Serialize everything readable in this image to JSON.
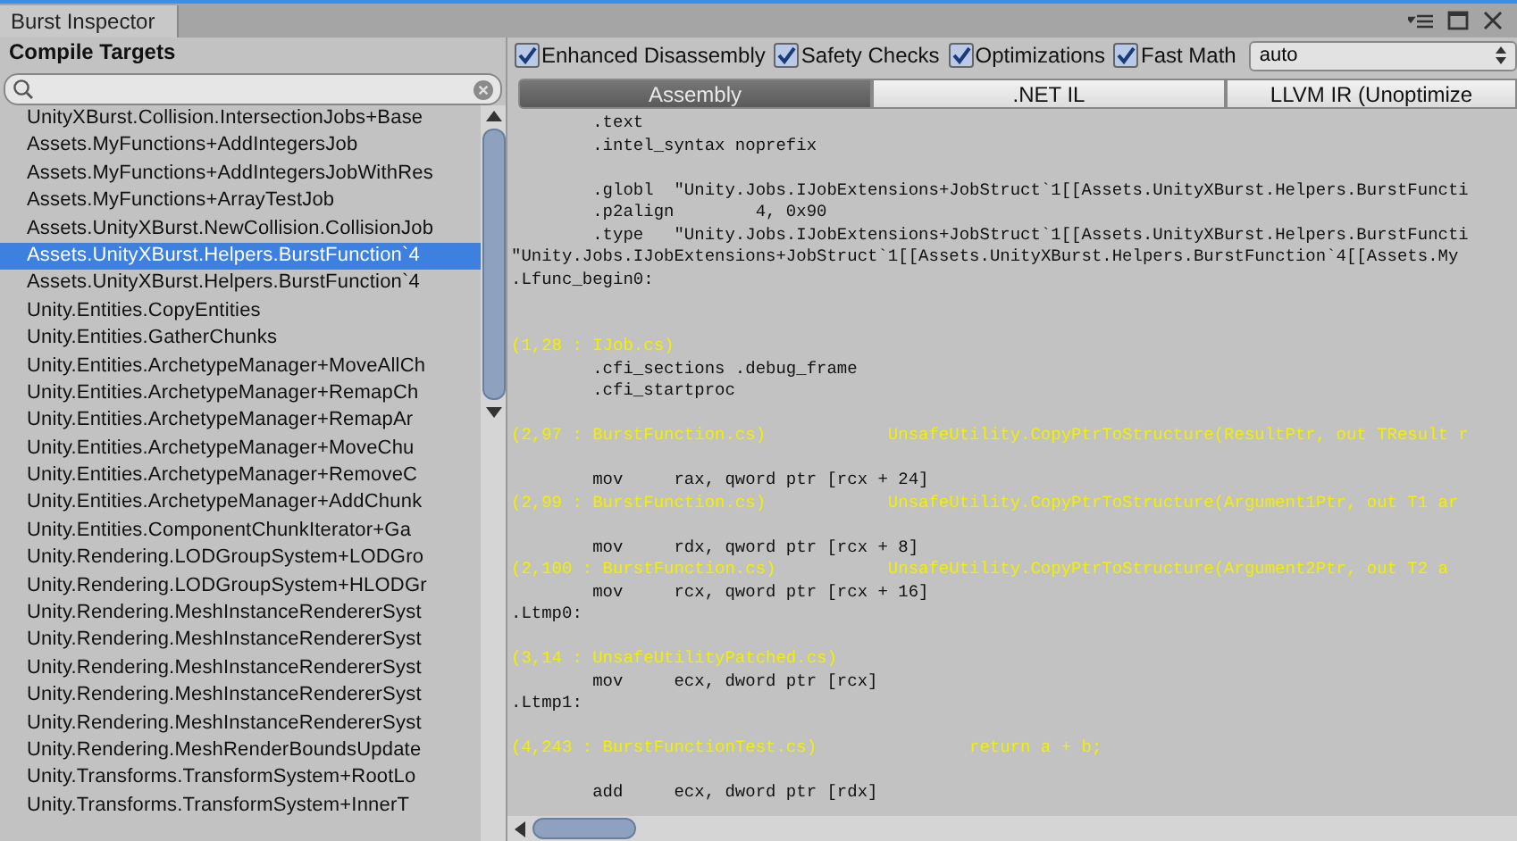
{
  "window": {
    "title": "Burst Inspector"
  },
  "sidebar": {
    "title": "Compile Targets",
    "items": [
      {
        "label": "UnityXBurst.Collision.IntersectionJobs+Base",
        "selected": false
      },
      {
        "label": "Assets.MyFunctions+AddIntegersJob",
        "selected": false
      },
      {
        "label": "Assets.MyFunctions+AddIntegersJobWithRes",
        "selected": false
      },
      {
        "label": "Assets.MyFunctions+ArrayTestJob",
        "selected": false
      },
      {
        "label": "Assets.UnityXBurst.NewCollision.CollisionJob",
        "selected": false
      },
      {
        "label": "Assets.UnityXBurst.Helpers.BurstFunction`4",
        "selected": true
      },
      {
        "label": "Assets.UnityXBurst.Helpers.BurstFunction`4",
        "selected": false
      },
      {
        "label": "Unity.Entities.CopyEntities",
        "selected": false
      },
      {
        "label": "Unity.Entities.GatherChunks",
        "selected": false
      },
      {
        "label": "Unity.Entities.ArchetypeManager+MoveAllCh",
        "selected": false
      },
      {
        "label": "Unity.Entities.ArchetypeManager+RemapCh",
        "selected": false
      },
      {
        "label": "Unity.Entities.ArchetypeManager+RemapAr",
        "selected": false
      },
      {
        "label": "Unity.Entities.ArchetypeManager+MoveChu",
        "selected": false
      },
      {
        "label": "Unity.Entities.ArchetypeManager+RemoveC",
        "selected": false
      },
      {
        "label": "Unity.Entities.ArchetypeManager+AddChunk",
        "selected": false
      },
      {
        "label": "Unity.Entities.ComponentChunkIterator+Ga",
        "selected": false
      },
      {
        "label": "Unity.Rendering.LODGroupSystem+LODGro",
        "selected": false
      },
      {
        "label": "Unity.Rendering.LODGroupSystem+HLODGr",
        "selected": false
      },
      {
        "label": "Unity.Rendering.MeshInstanceRendererSyst",
        "selected": false
      },
      {
        "label": "Unity.Rendering.MeshInstanceRendererSyst",
        "selected": false
      },
      {
        "label": "Unity.Rendering.MeshInstanceRendererSyst",
        "selected": false
      },
      {
        "label": "Unity.Rendering.MeshInstanceRendererSyst",
        "selected": false
      },
      {
        "label": "Unity.Rendering.MeshInstanceRendererSyst",
        "selected": false
      },
      {
        "label": "Unity.Rendering.MeshRenderBoundsUpdate",
        "selected": false
      },
      {
        "label": "Unity.Transforms.TransformSystem+RootLo",
        "selected": false
      },
      {
        "label": "Unity.Transforms.TransformSystem+InnerT",
        "selected": false
      }
    ]
  },
  "options": [
    {
      "label": "Enhanced Disassembly",
      "checked": true
    },
    {
      "label": "Safety Checks",
      "checked": true
    },
    {
      "label": "Optimizations",
      "checked": true
    },
    {
      "label": "Fast Math",
      "checked": true
    }
  ],
  "target_dropdown": {
    "value": "auto"
  },
  "tabs": [
    {
      "label": "Assembly",
      "selected": true
    },
    {
      "label": ".NET IL",
      "selected": false
    },
    {
      "label": "LLVM IR (Unoptimize",
      "selected": false
    }
  ],
  "code_lines": [
    {
      "kind": "asm",
      "text": "        .text"
    },
    {
      "kind": "asm",
      "text": "        .intel_syntax noprefix"
    },
    {
      "kind": "blank"
    },
    {
      "kind": "asm",
      "text": "        .globl  \"Unity.Jobs.IJobExtensions+JobStruct`1[[Assets.UnityXBurst.Helpers.BurstFuncti"
    },
    {
      "kind": "asm",
      "text": "        .p2align        4, 0x90"
    },
    {
      "kind": "asm",
      "text": "        .type   \"Unity.Jobs.IJobExtensions+JobStruct`1[[Assets.UnityXBurst.Helpers.BurstFuncti"
    },
    {
      "kind": "asm",
      "text": "\"Unity.Jobs.IJobExtensions+JobStruct`1[[Assets.UnityXBurst.Helpers.BurstFunction`4[[Assets.My"
    },
    {
      "kind": "asm",
      "text": ".Lfunc_begin0:"
    },
    {
      "kind": "blank"
    },
    {
      "kind": "blank"
    },
    {
      "kind": "source",
      "location": "(1,28 : IJob.cs)"
    },
    {
      "kind": "asm",
      "text": "        .cfi_sections .debug_frame"
    },
    {
      "kind": "asm",
      "text": "        .cfi_startproc"
    },
    {
      "kind": "blank"
    },
    {
      "kind": "source",
      "location": "(2,97 : BurstFunction.cs)",
      "code": "UnsafeUtility.CopyPtrToStructure(ResultPtr, out TResult r"
    },
    {
      "kind": "blank"
    },
    {
      "kind": "asm",
      "text": "        mov     rax, qword ptr [rcx + 24]"
    },
    {
      "kind": "source",
      "location": "(2,99 : BurstFunction.cs)",
      "code": "UnsafeUtility.CopyPtrToStructure(Argument1Ptr, out T1 ar"
    },
    {
      "kind": "blank"
    },
    {
      "kind": "asm",
      "text": "        mov     rdx, qword ptr [rcx + 8]"
    },
    {
      "kind": "source",
      "location": "(2,100 : BurstFunction.cs)",
      "code": "UnsafeUtility.CopyPtrToStructure(Argument2Ptr, out T2 a"
    },
    {
      "kind": "asm",
      "text": "        mov     rcx, qword ptr [rcx + 16]"
    },
    {
      "kind": "asm",
      "text": ".Ltmp0:"
    },
    {
      "kind": "blank"
    },
    {
      "kind": "source",
      "location": "(3,14 : UnsafeUtilityPatched.cs)"
    },
    {
      "kind": "asm",
      "text": "        mov     ecx, dword ptr [rcx]"
    },
    {
      "kind": "asm",
      "text": ".Ltmp1:"
    },
    {
      "kind": "blank"
    },
    {
      "kind": "source",
      "location": "(4,243 : BurstFunctionTest.cs)",
      "code": "        return a + b;"
    },
    {
      "kind": "blank"
    },
    {
      "kind": "asm",
      "text": "        add     ecx, dword ptr [rdx]"
    }
  ]
}
